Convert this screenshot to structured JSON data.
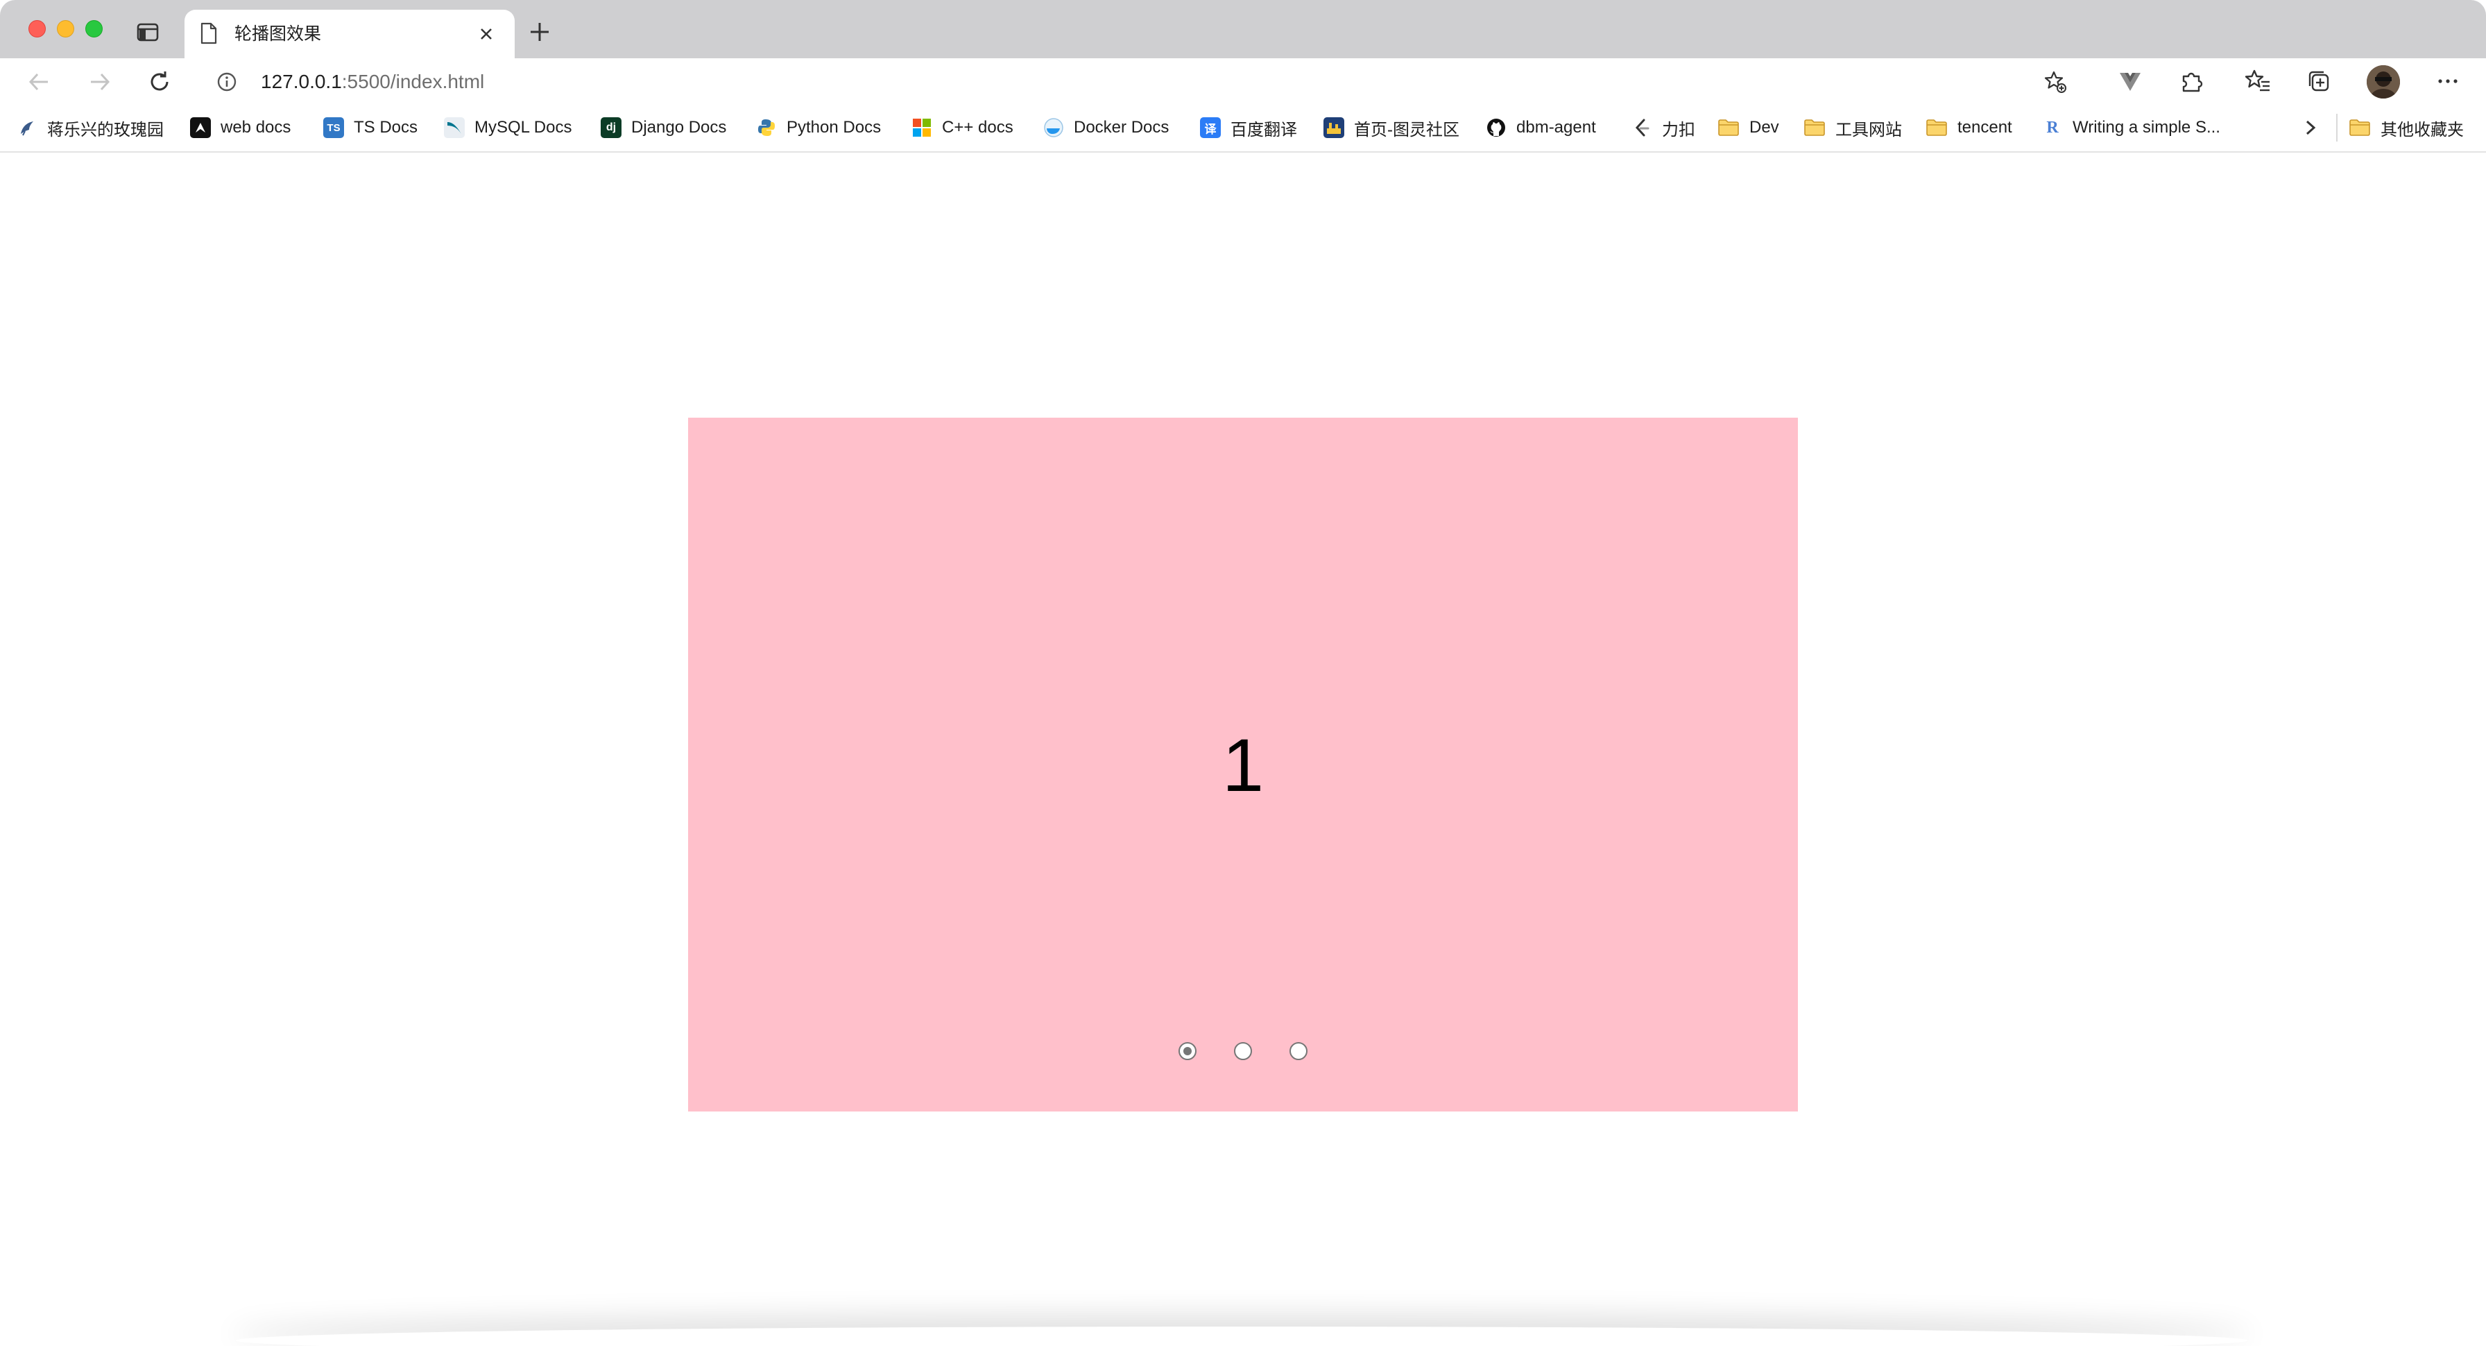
{
  "browser": {
    "tab": {
      "title": "轮播图效果"
    },
    "address_bar": {
      "url_host": "127.0.0.1",
      "url_rest": ":5500/index.html"
    },
    "bookmarks": [
      {
        "label": "蒋乐兴的玫瑰园",
        "icon": "bird-icon"
      },
      {
        "label": "web docs",
        "icon": "mdn-icon"
      },
      {
        "label": "TS Docs",
        "icon": "typescript-icon"
      },
      {
        "label": "MySQL Docs",
        "icon": "mysql-icon"
      },
      {
        "label": "Django Docs",
        "icon": "django-icon"
      },
      {
        "label": "Python Docs",
        "icon": "python-icon"
      },
      {
        "label": "C++ docs",
        "icon": "microsoft-icon"
      },
      {
        "label": "Docker Docs",
        "icon": "docker-icon"
      },
      {
        "label": "百度翻译",
        "icon": "baidu-translate-icon"
      },
      {
        "label": "首页-图灵社区",
        "icon": "turing-icon"
      },
      {
        "label": "dbm-agent",
        "icon": "github-icon"
      },
      {
        "label": "力扣",
        "icon": "leetcode-icon"
      },
      {
        "label": "Dev",
        "icon": "folder-icon"
      },
      {
        "label": "工具网站",
        "icon": "folder-icon"
      },
      {
        "label": "tencent",
        "icon": "folder-icon"
      },
      {
        "label": "Writing a simple S...",
        "icon": "r-icon"
      }
    ],
    "other_bookmarks": {
      "label": "其他收藏夹",
      "icon": "folder-icon"
    }
  },
  "page": {
    "carousel": {
      "background": "#ffc0cb",
      "current_slide_label": "1",
      "indicator_count": 3,
      "selected_indicator": 0
    }
  },
  "colors": {
    "tabstrip": "#cfcfd1",
    "folder": "#f4c542"
  }
}
